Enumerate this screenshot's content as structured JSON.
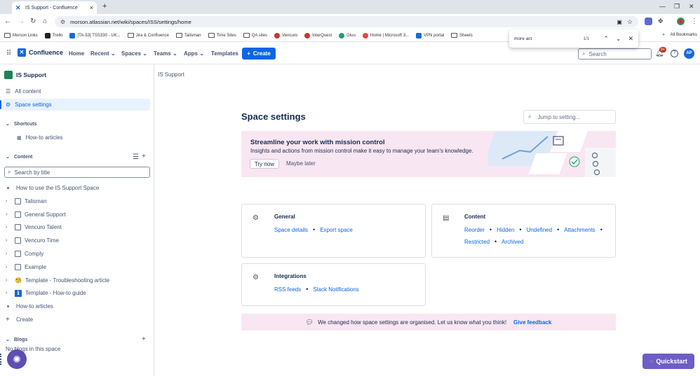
{
  "browser": {
    "tab_title": "IS Support - Confluence",
    "url": "morson.atlassian.net/wiki/spaces/ISS/settings/home",
    "new_tab": "+",
    "bookmarks": [
      {
        "label": "Morson Links",
        "kind": "folder"
      },
      {
        "label": "Trello",
        "kind": "site",
        "color": "#222222"
      },
      {
        "label": "[TA-53] TSS330 - UK...",
        "kind": "site",
        "color": "#1868db"
      },
      {
        "label": "Jira & Confluence",
        "kind": "folder"
      },
      {
        "label": "Talisman",
        "kind": "folder"
      },
      {
        "label": "Time Sites",
        "kind": "folder"
      },
      {
        "label": "QA sites",
        "kind": "folder"
      },
      {
        "label": "Vencuro",
        "kind": "site",
        "color": "#c9372c"
      },
      {
        "label": "InterQuest",
        "kind": "site",
        "color": "#c9372c"
      },
      {
        "label": "Gluu",
        "kind": "site",
        "color": "#22a06b"
      },
      {
        "label": "Home | Microsoft 3...",
        "kind": "site",
        "color": "#c9372c"
      },
      {
        "label": "VPN portal",
        "kind": "site",
        "color": "#1868db"
      },
      {
        "label": "Sheets",
        "kind": "folder"
      }
    ],
    "all_bookmarks": "All Bookmarks",
    "find": {
      "query": "more act",
      "count": "1/1"
    }
  },
  "app": {
    "product": "Confluence",
    "nav": [
      "Home",
      "Recent",
      "Spaces",
      "Teams",
      "Apps",
      "Templates"
    ],
    "create_label": "Create",
    "search_placeholder": "Search",
    "notif_badge": "9+",
    "avatar_initials": "AP"
  },
  "sidebar": {
    "space_name": "IS Support",
    "all_content": "All content",
    "space_settings": "Space settings",
    "shortcuts_label": "Shortcuts",
    "shortcut_item": "How-to articles",
    "content_label": "Content",
    "search_placeholder": "Search by title",
    "tree": [
      {
        "label": "How to use the IS Support Space",
        "type": "dot"
      },
      {
        "label": "Talisman",
        "type": "page"
      },
      {
        "label": "General Support",
        "type": "page"
      },
      {
        "label": "Vencuro Talent",
        "type": "page"
      },
      {
        "label": "Vencuro Time",
        "type": "page"
      },
      {
        "label": "Comply",
        "type": "page"
      },
      {
        "label": "Example",
        "type": "page"
      },
      {
        "label": "Template - Troubleshooting article",
        "type": "emoji",
        "emoji": "🧐"
      },
      {
        "label": "Template - How-to guide",
        "type": "emoji",
        "emoji": "ℹ"
      },
      {
        "label": "How-to articles",
        "type": "dot"
      }
    ],
    "create_label": "Create",
    "blogs_label": "Blogs",
    "blogs_empty": "No blogs in this space"
  },
  "main": {
    "breadcrumb": "IS Support",
    "title": "Space settings",
    "jump_placeholder": "Jump to setting...",
    "banner": {
      "heading": "Streamline your work with mission control",
      "text": "Insights and actions from mission control make it easy to manage your team's knowledge.",
      "try_label": "Try now",
      "later_label": "Maybe later"
    },
    "general": {
      "title": "General",
      "links": [
        "Space details",
        "Export space"
      ]
    },
    "content": {
      "title": "Content",
      "links_row1": [
        "Reorder",
        "Hidden",
        "Undefined",
        "Attachments"
      ],
      "links_row2": [
        "Restricted",
        "Archived"
      ]
    },
    "integrations": {
      "title": "Integrations",
      "links": [
        "RSS feeds",
        "Slack Notifications"
      ]
    },
    "feedback": {
      "text": "We changed how space settings are organised. Let us know what you think!",
      "link": "Give feedback"
    }
  },
  "quickstart": "Quickstart",
  "colors": {
    "accent": "#0c66e4",
    "banner_bg": "#f8e6f2",
    "quickstart": "#6e5dc6"
  }
}
